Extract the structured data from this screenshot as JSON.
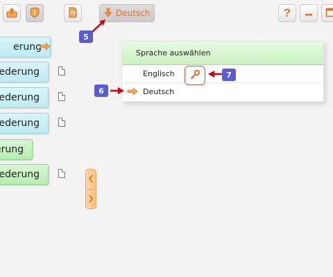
{
  "toolbar": {
    "language_button_label": "Deutsch",
    "icons": [
      "export-icon",
      "shield-icon",
      "document-refresh-icon",
      "arrow-down-icon",
      "help-icon",
      "minimize-icon",
      "maximize-icon"
    ],
    "help_label": "?"
  },
  "callouts": {
    "five": "5",
    "six": "6",
    "seven": "7"
  },
  "tree": {
    "items": [
      {
        "label": "erung"
      },
      {
        "label": "ederung"
      },
      {
        "label": "ederung"
      },
      {
        "label": "ederung"
      },
      {
        "label": "erung"
      },
      {
        "label": "ederung"
      }
    ]
  },
  "language_panel": {
    "title": "Sprache auswählen",
    "options": [
      {
        "label": "Englisch"
      },
      {
        "label": "Deutsch"
      }
    ]
  },
  "colors": {
    "accent_orange": "#e0702a",
    "callout_blue": "#5b5bd6",
    "callout_arrow_red": "#d40000",
    "item_cyan": "#bdeaf1",
    "item_green": "#b9ecb2"
  }
}
